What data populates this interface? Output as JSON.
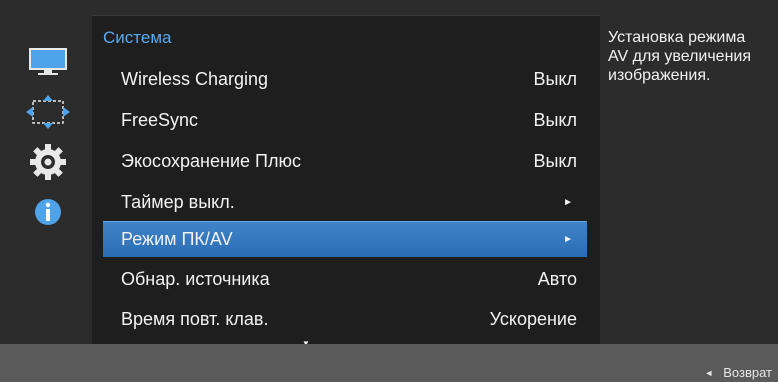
{
  "menu": {
    "title": "Система",
    "items": [
      {
        "label": "Wireless Charging",
        "value": "Выкл",
        "arrow": ""
      },
      {
        "label": "FreeSync",
        "value": "Выкл",
        "arrow": ""
      },
      {
        "label": "Экосохранение Плюс",
        "value": "Выкл",
        "arrow": ""
      },
      {
        "label": "Таймер выкл.",
        "value": "",
        "arrow": "►"
      },
      {
        "label": "Режим ПК/AV",
        "value": "",
        "arrow": "►"
      },
      {
        "label": "Обнар. источника",
        "value": "Авто",
        "arrow": ""
      },
      {
        "label": "Время повт. клав.",
        "value": "Ускорение",
        "arrow": ""
      }
    ],
    "selected_index": 4,
    "scroll_indicator": "▼"
  },
  "help": {
    "text": "Установка режима AV для увеличения изображения."
  },
  "footer": {
    "back_arrow": "◄",
    "back_label": "Возврат"
  },
  "sidebar": {
    "icons": [
      "picture-icon",
      "screen-adjust-icon",
      "system-gear-icon",
      "info-icon"
    ]
  },
  "colors": {
    "accent": "#5aa8ee",
    "selection": "#2f74bd",
    "panel": "#1e1e1e",
    "background": "#2c2c2c",
    "footer": "#5a5a5a"
  }
}
